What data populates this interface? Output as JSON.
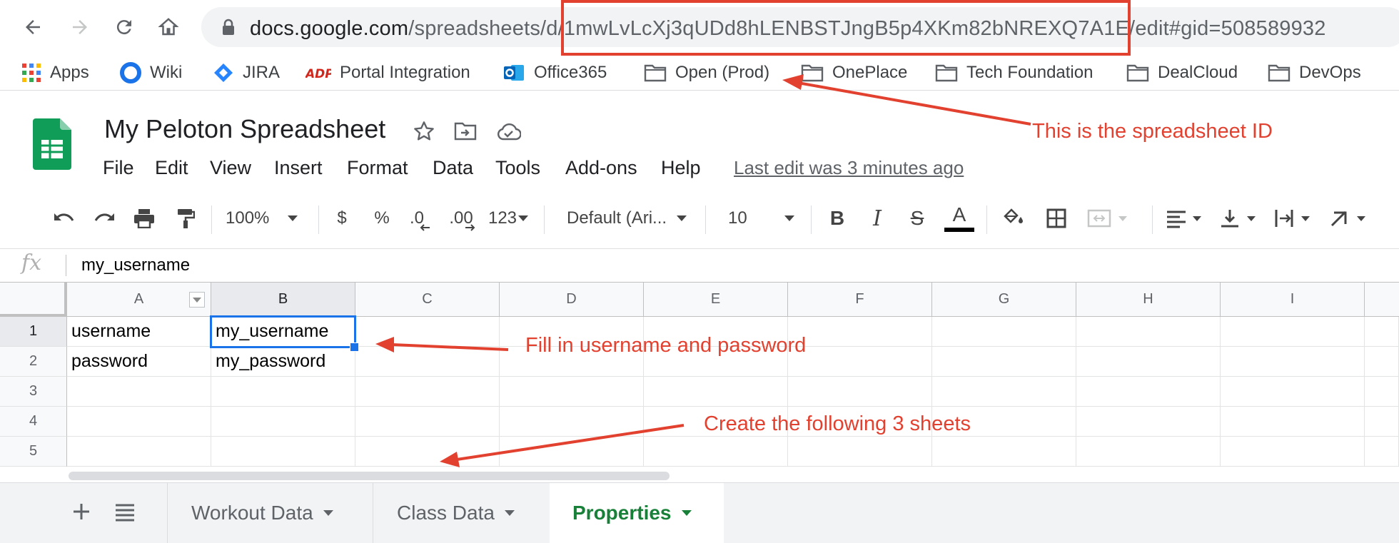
{
  "browser": {
    "url_host": "docs.google.com",
    "url_path": "/spreadsheets/d/1mwLvLcXj3qUDd8hLENBSTJngB5p4XKm82bNREXQ7A1E/edit#gid=508589932",
    "bookmarks": [
      "Apps",
      "Wiki",
      "JIRA",
      "Portal Integration",
      "Office365",
      "Open (Prod)",
      "OnePlace",
      "Tech Foundation",
      "DealCloud",
      "DevOps"
    ]
  },
  "doc": {
    "title": "My Peloton Spreadsheet",
    "menu": [
      "File",
      "Edit",
      "View",
      "Insert",
      "Format",
      "Data",
      "Tools",
      "Add-ons",
      "Help"
    ],
    "last_edit": "Last edit was 3 minutes ago"
  },
  "toolbar": {
    "zoom": "100%",
    "currency": "$",
    "percent": "%",
    "dec_less": ".0",
    "dec_more": ".00",
    "format_more": "123",
    "font": "Default (Ari...",
    "font_size": "10",
    "bold": "B",
    "italic": "I",
    "strike": "S",
    "text_color": "A"
  },
  "formula": {
    "fx": "fx",
    "value": "my_username"
  },
  "grid": {
    "columns": [
      "A",
      "B",
      "C",
      "D",
      "E",
      "F",
      "G",
      "H",
      "I"
    ],
    "rows": [
      "1",
      "2",
      "3",
      "4",
      "5"
    ],
    "cells": [
      [
        "username",
        "my_username"
      ],
      [
        "password",
        "my_password"
      ]
    ]
  },
  "sheets": [
    "Workout Data",
    "Class Data",
    "Properties"
  ],
  "annotations": {
    "id": "This is the spreadsheet ID",
    "fill": "Fill in username and password",
    "create": "Create the following 3 sheets"
  },
  "colors": {
    "annotation": "#e2412f",
    "sheets_green": "#188038",
    "selection": "#1a73e8"
  }
}
